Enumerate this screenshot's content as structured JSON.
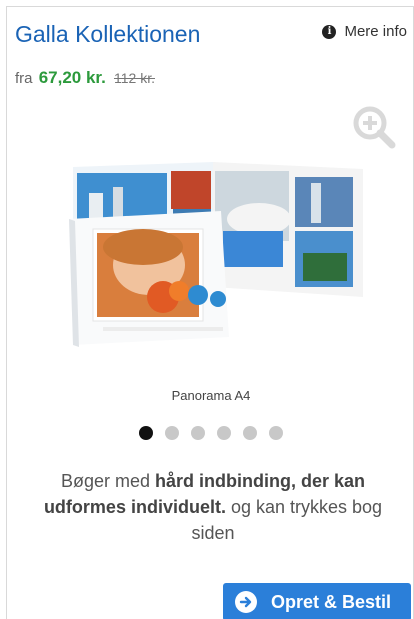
{
  "product": {
    "title": "Galla Kollektionen",
    "more_info_label": "Mere info",
    "price": {
      "prefix": "fra",
      "current": "67,20 kr.",
      "old": "112 kr."
    },
    "image_caption": "Panorama A4",
    "carousel": {
      "total_slides": 6,
      "active_index": 0
    },
    "description": {
      "part1": "Bøger med ",
      "bold": "hård indbinding, der kan udformes individuelt.",
      "part2": " og kan trykkes bog siden"
    },
    "order_button_label": "Opret & Bestil"
  },
  "colors": {
    "title": "#1a63b5",
    "price_current": "#2c9a3c",
    "button": "#2b7fd9"
  },
  "icons": {
    "info": "info-circle-icon",
    "zoom": "zoom-in-icon",
    "order": "arrow-right-circle-icon"
  }
}
